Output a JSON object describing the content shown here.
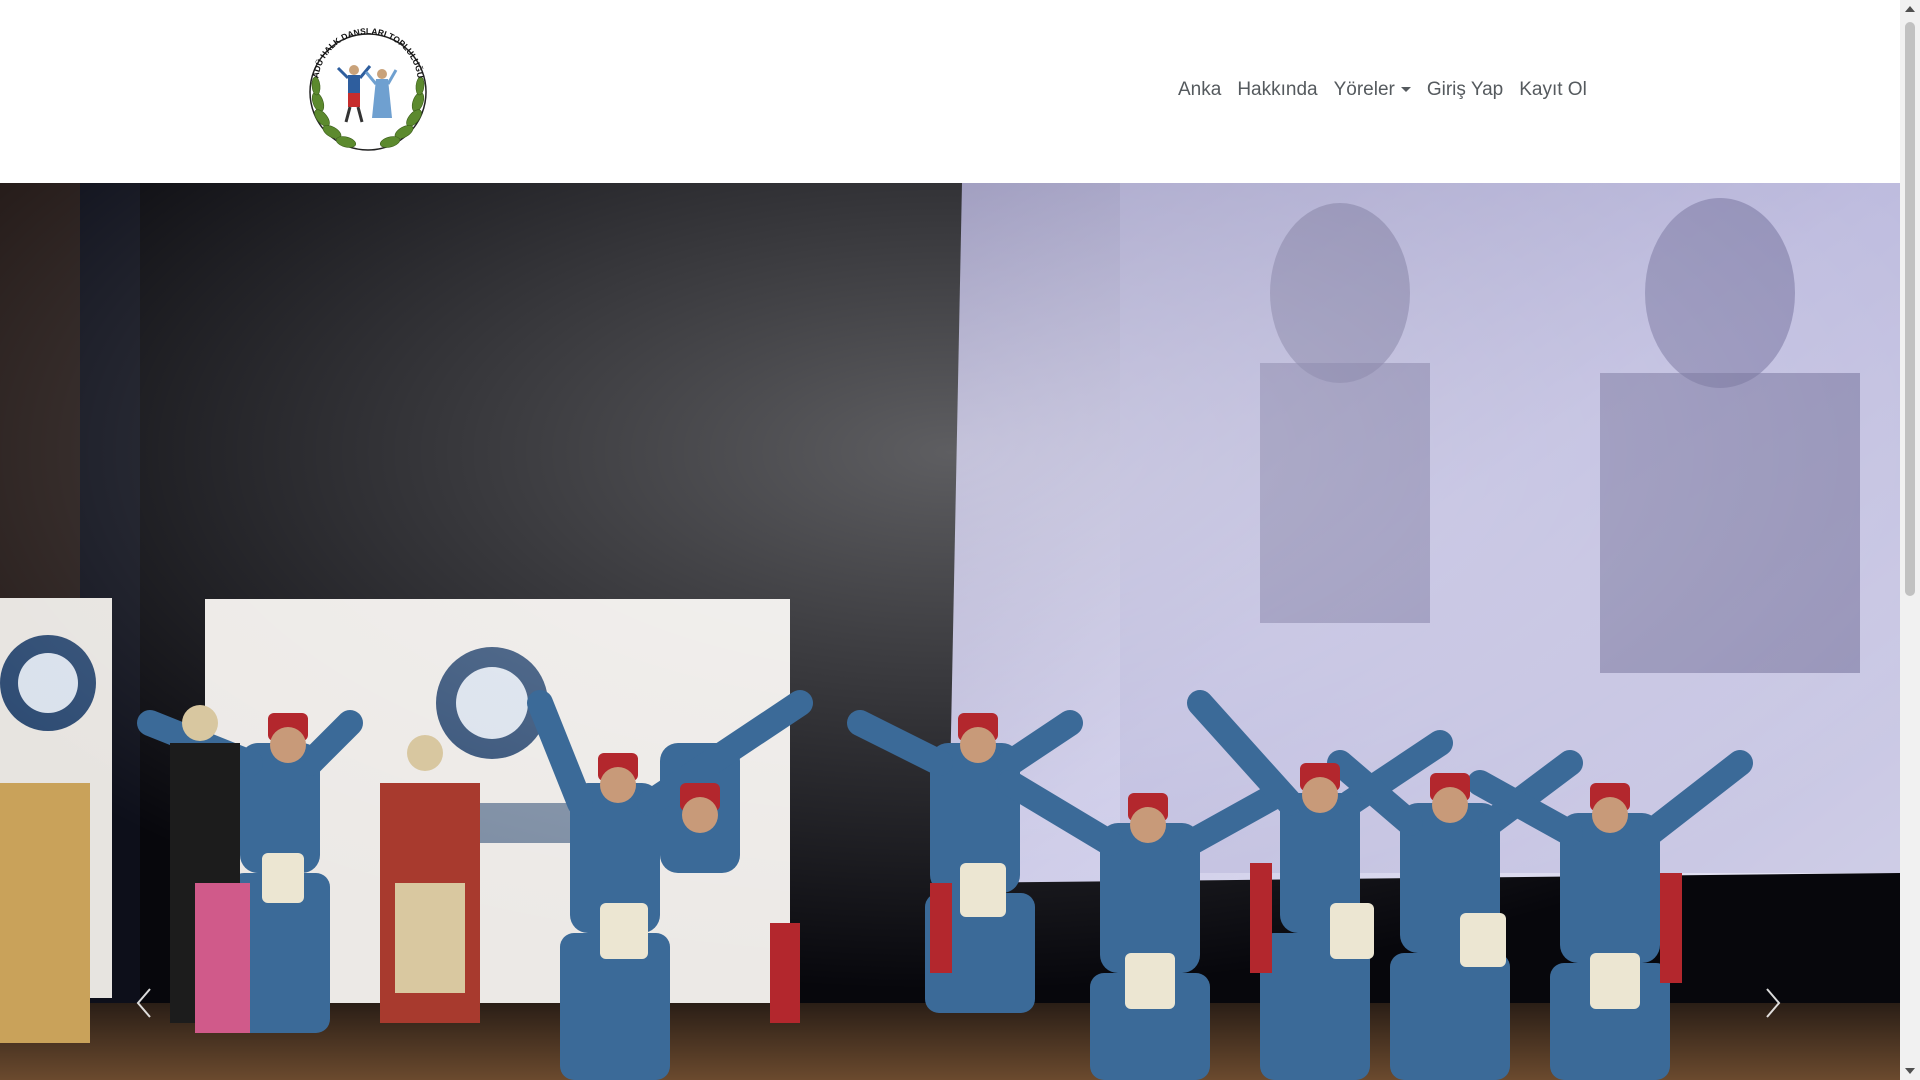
{
  "brand": {
    "logo_text": "ADÜ HALK DANSLARI TOPLULUĞU",
    "logo_icon": "folk-dancers-wreath-logo"
  },
  "nav": {
    "items": [
      {
        "label": "Anka"
      },
      {
        "label": "Hakkında"
      },
      {
        "label": "Yöreler",
        "dropdown": true
      },
      {
        "label": "Giriş Yap"
      },
      {
        "label": "Kayıt Ol"
      }
    ]
  },
  "hero": {
    "image_icon": "folk-dance-performance-photo",
    "prev_icon": "chevron-left-icon",
    "next_icon": "chevron-right-icon"
  },
  "colors": {
    "nav_text": "#555a5e",
    "costume_blue": "#3b6a98",
    "fez_red": "#b3272d"
  }
}
